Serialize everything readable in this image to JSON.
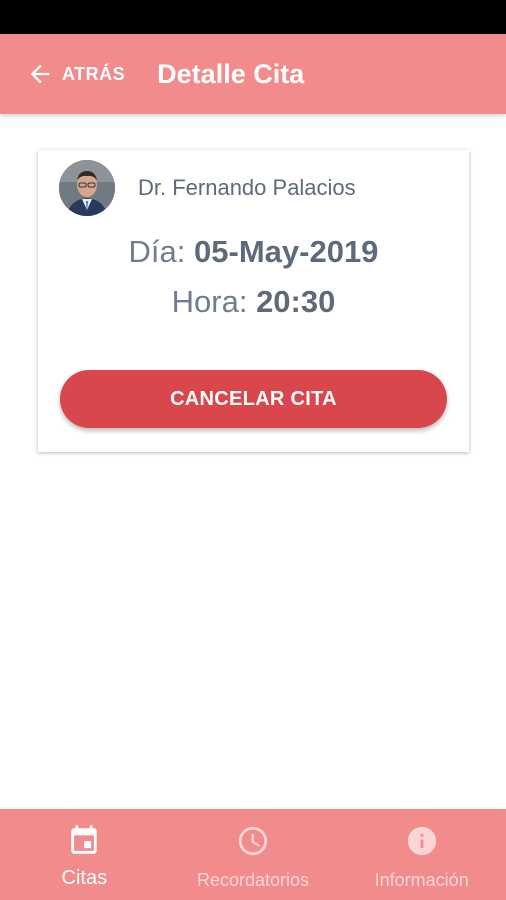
{
  "colors": {
    "app_bar": "#f28b8b",
    "cancel_button": "#d9474d",
    "text_primary": "#5d6a7b",
    "nav_active": "#ffffff",
    "nav_inactive": "#fbd5d5"
  },
  "header": {
    "back_label": "ATRÁS",
    "back_icon": "arrow-left-icon",
    "title": "Detalle Cita"
  },
  "appointment": {
    "doctor_name": "Dr. Fernando Palacios",
    "avatar": "doctor-photo",
    "day_label": "Día:",
    "day_value": "05-May-2019",
    "time_label": "Hora:",
    "time_value": "20:30",
    "cancel_label": "CANCELAR CITA"
  },
  "bottom_nav": {
    "items": [
      {
        "label": "Citas",
        "icon": "calendar-icon",
        "active": true
      },
      {
        "label": "Recordatorios",
        "icon": "clock-icon",
        "active": false
      },
      {
        "label": "Información",
        "icon": "info-icon",
        "active": false
      }
    ]
  }
}
